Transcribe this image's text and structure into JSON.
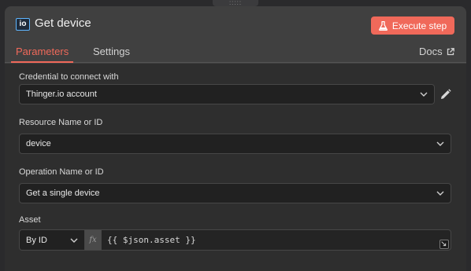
{
  "node": {
    "icon_text": "io",
    "title": "Get device",
    "execute_label": "Execute step"
  },
  "tabs": {
    "parameters": "Parameters",
    "settings": "Settings",
    "docs": "Docs"
  },
  "fields": {
    "credential": {
      "label": "Credential to connect with",
      "value": "Thinger.io account"
    },
    "resource": {
      "label": "Resource Name or ID",
      "value": "device"
    },
    "operation": {
      "label": "Operation Name or ID",
      "value": "Get a single device"
    },
    "asset": {
      "label": "Asset",
      "mode": "By ID",
      "fx": "fx",
      "expression": "{{ $json.asset }}"
    }
  },
  "colors": {
    "accent": "#f0695a",
    "panel": "#404040",
    "body": "#2e2e2e",
    "input": "#212121"
  }
}
